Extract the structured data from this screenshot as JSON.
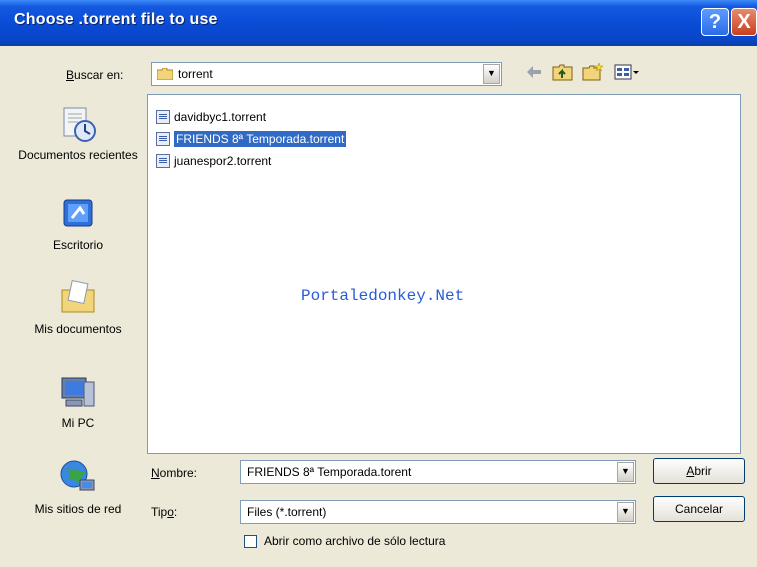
{
  "dialog": {
    "title": "Choose .torrent file to use",
    "help_button": "?",
    "close_button": "X"
  },
  "lookin": {
    "label_prefix": "",
    "label_hotkey": "B",
    "label_rest": "uscar en:",
    "value": "torrent"
  },
  "places": [
    {
      "label": "Documentos recientes",
      "icon": "recent-documents-icon"
    },
    {
      "label": "Escritorio",
      "icon": "desktop-icon"
    },
    {
      "label": "Mis documentos",
      "icon": "my-documents-icon"
    },
    {
      "label": "Mi PC",
      "icon": "my-computer-icon"
    },
    {
      "label": "Mis sitios de red",
      "icon": "network-places-icon"
    }
  ],
  "files": [
    {
      "name": "davidbyc1.torrent",
      "selected": false
    },
    {
      "name": "FRIENDS 8ª Temporada.torrent",
      "selected": true
    },
    {
      "name": "juanespor2.torrent",
      "selected": false
    }
  ],
  "watermark": "Portaledonkey.Net",
  "filename": {
    "label_hotkey": "N",
    "label_rest": "ombre:",
    "value": "FRIENDS 8ª Temporada.torent"
  },
  "filetype": {
    "label_prefix": "Tip",
    "label_hotkey": "o",
    "label_rest": ":",
    "value": "Files (*.torrent)"
  },
  "readonly": {
    "label": "Abrir como archivo de sólo lectura",
    "checked": false
  },
  "buttons": {
    "open_hotkey": "A",
    "open_rest": "brir",
    "cancel": "Cancelar"
  },
  "colors": {
    "title_bar": "#0a4cd6",
    "selection": "#316ac5",
    "dialog_bg": "#ece9d8"
  }
}
